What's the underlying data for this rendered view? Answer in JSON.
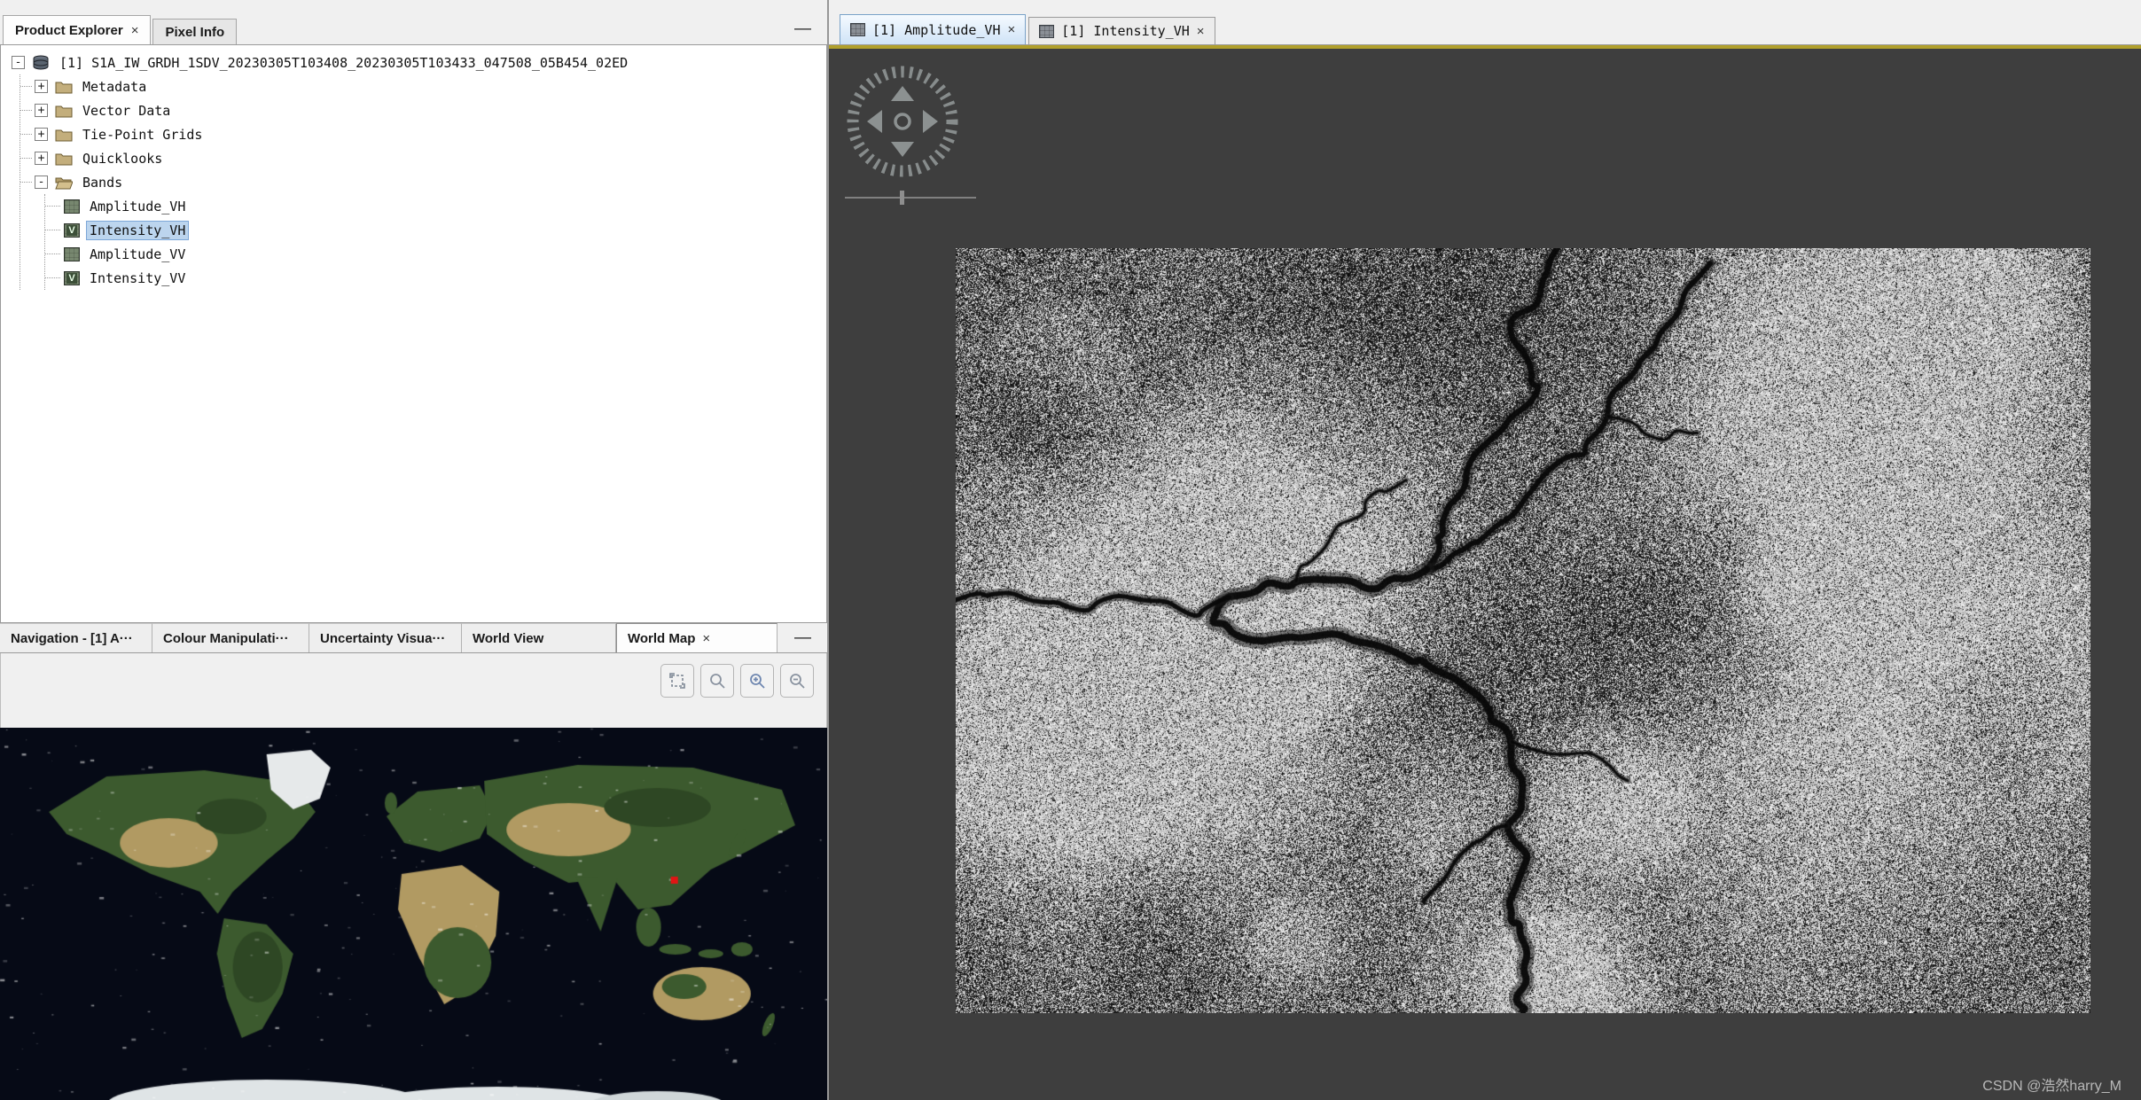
{
  "glyphs": {
    "close": "×",
    "minimize": "—",
    "expanded": "-",
    "collapsed": "+"
  },
  "explorer": {
    "tabs": [
      {
        "label": "Product Explorer",
        "close": "×"
      },
      {
        "label": "Pixel Info"
      }
    ],
    "tree": {
      "product_label": "[1] S1A_IW_GRDH_1SDV_20230305T103408_20230305T103433_047508_05B454_02ED",
      "folders": [
        {
          "label": "Metadata"
        },
        {
          "label": "Vector Data"
        },
        {
          "label": "Tie-Point Grids"
        },
        {
          "label": "Quicklooks"
        },
        {
          "label": "Bands"
        }
      ],
      "bands": [
        {
          "label": "Amplitude_VH",
          "kind": "amplitude"
        },
        {
          "label": "Intensity_VH",
          "kind": "intensity",
          "selected": true
        },
        {
          "label": "Amplitude_VV",
          "kind": "amplitude"
        },
        {
          "label": "Intensity_VV",
          "kind": "intensity"
        }
      ],
      "intensity_badge": "V"
    }
  },
  "tools": {
    "tabs": [
      {
        "label": "Navigation - [1] A···"
      },
      {
        "label": "Colour Manipulati···"
      },
      {
        "label": "Uncertainty Visua···"
      },
      {
        "label": "World View"
      },
      {
        "label": "World Map",
        "close": "×",
        "active": true
      }
    ]
  },
  "docs": {
    "tabs": [
      {
        "label": "[1] Amplitude_VH",
        "close": "×",
        "active": true
      },
      {
        "label": "[1] Intensity_VH",
        "close": "×"
      }
    ]
  },
  "view": {
    "background": "#3e3e3e",
    "focus_border": "#b1a02c"
  },
  "watermark": "CSDN @浩然harry_M"
}
